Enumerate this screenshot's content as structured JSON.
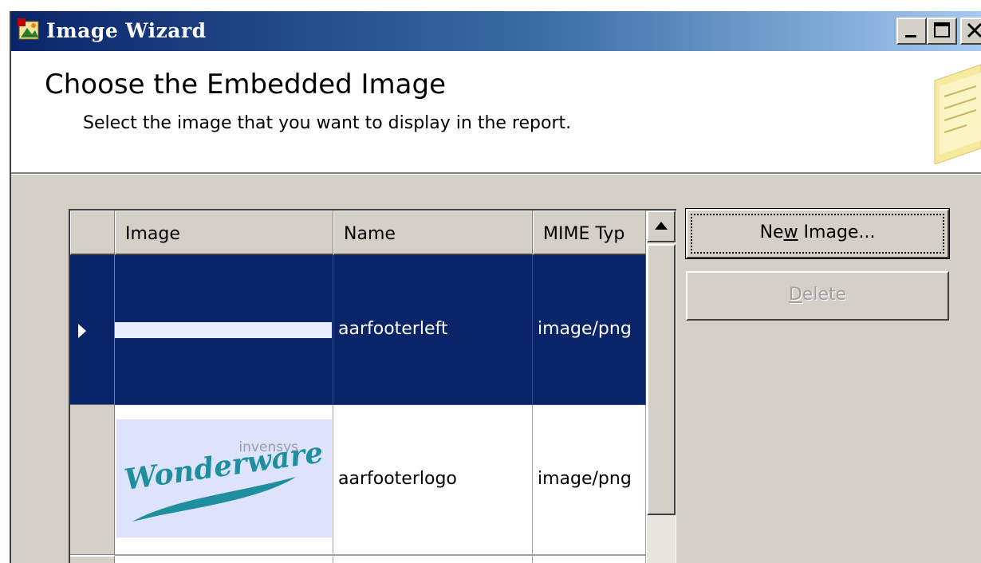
{
  "window": {
    "title": "Image Wizard",
    "colors": {
      "titlebar_start": "#0a246a",
      "titlebar_end": "#a6caf0",
      "selection": "#0a246a",
      "face": "#d4d0c8"
    }
  },
  "header": {
    "title": "Choose the Embedded Image",
    "subtitle": "Select the image that you want to display in the report."
  },
  "grid": {
    "columns": [
      "Image",
      "Name",
      "MIME Typ"
    ],
    "rows": [
      {
        "image": "white-bar-image",
        "name": "aarfooterleft",
        "mime": "image/png",
        "selected": true
      },
      {
        "image": "wonderware-logo",
        "logo_text": "Wonderware",
        "logo_sub": "invensys",
        "name": "aarfooterlogo",
        "mime": "image/png",
        "selected": false
      }
    ]
  },
  "buttons": {
    "new_image_pre": "Ne",
    "new_image_key": "w",
    "new_image_post": " Image...",
    "delete_key": "D",
    "delete_post": "elete"
  }
}
